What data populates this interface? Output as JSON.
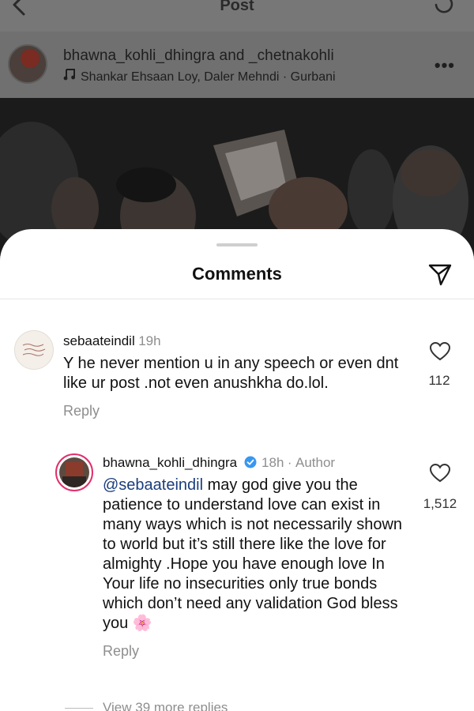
{
  "topbar": {
    "title": "Post"
  },
  "post": {
    "authors": "bhawna_kohli_dhingra and _chetnakohli",
    "music": "Shankar Ehsaan Loy, Daler Mehndi · Gurbani"
  },
  "comments_sheet": {
    "title": "Comments",
    "comments": [
      {
        "username": "sebaateindil",
        "time": "19h",
        "text": "Y he never mention u in any speech or even dnt like ur post .not even anushkha do.lol.",
        "likes": "112",
        "reply_label": "Reply"
      }
    ],
    "reply": {
      "username": "bhawna_kohli_dhingra",
      "time": "18h",
      "author_badge": "Author",
      "mention": "@sebaateindil",
      "text": "may god give you the patience to understand love can exist in many ways which is not necessarily shown to world but it’s still there like the love for almighty .Hope  you have enough love In Your life no insecurities only true bonds which don’t need any validation God bless you",
      "emoji": "🌸",
      "likes": "1,512",
      "reply_label": "Reply"
    },
    "view_more": "View 39 more replies"
  },
  "icons": {
    "back": "chevron-left-icon",
    "refresh": "refresh-icon",
    "more": "more-icon",
    "music": "music-note-icon",
    "send": "send-icon",
    "heart": "heart-icon",
    "verified": "verified-badge-icon"
  },
  "colors": {
    "mention": "#1a3e7c",
    "verified": "#3897f0",
    "muted": "#8e8e8e"
  }
}
